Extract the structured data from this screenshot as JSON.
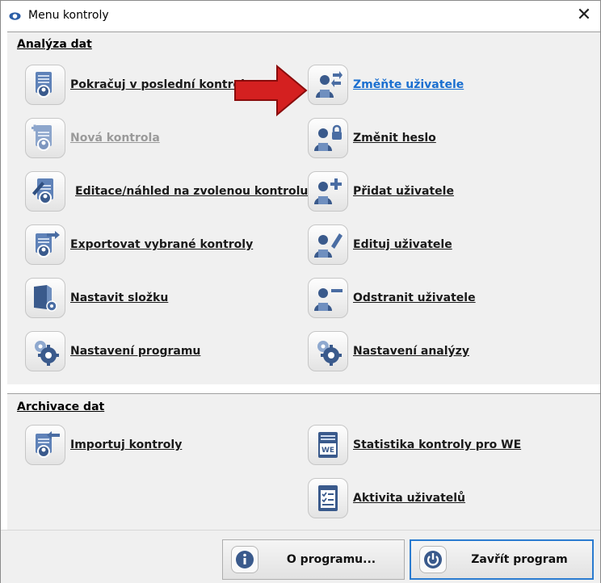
{
  "window": {
    "title": "Menu kontroly",
    "close_glyph": "✕"
  },
  "sections": {
    "analyza": {
      "title": "Analýza dat",
      "left": [
        {
          "label": "Pokračuj v poslední kontrole",
          "icon": "continue-document-icon",
          "state": "normal"
        },
        {
          "label": "Nová kontrola",
          "icon": "new-document-icon",
          "state": "disabled"
        },
        {
          "label": "Editace/náhled na zvolenou kontrolu",
          "icon": "edit-document-icon",
          "state": "normal"
        },
        {
          "label": "Exportovat vybrané kontroly",
          "icon": "export-document-icon",
          "state": "normal"
        },
        {
          "label": "Nastavit složku",
          "icon": "folder-settings-icon",
          "state": "normal"
        },
        {
          "label": "Nastavení programu",
          "icon": "gears-icon",
          "state": "normal"
        }
      ],
      "right": [
        {
          "label": "Změňte uživatele",
          "icon": "switch-user-icon",
          "state": "hover"
        },
        {
          "label": "Změnit heslo",
          "icon": "user-lock-icon",
          "state": "normal"
        },
        {
          "label": "Přidat uživatele",
          "icon": "user-add-icon",
          "state": "normal"
        },
        {
          "label": "Edituj uživatele",
          "icon": "user-edit-icon",
          "state": "normal"
        },
        {
          "label": "Odstranit uživatele",
          "icon": "user-remove-icon",
          "state": "normal"
        },
        {
          "label": "Nastavení analýzy",
          "icon": "gears-icon",
          "state": "normal"
        }
      ]
    },
    "archivace": {
      "title": "Archivace dat",
      "left": [
        {
          "label": "Importuj kontroly",
          "icon": "import-document-icon",
          "state": "normal"
        }
      ],
      "right": [
        {
          "label": "Statistika kontroly pro WE",
          "icon": "statistics-we-icon",
          "state": "normal",
          "badge": "WE"
        },
        {
          "label": "Aktivita uživatelů",
          "icon": "user-activity-icon",
          "state": "normal"
        }
      ]
    }
  },
  "bottom": {
    "about_label": "O programu...",
    "close_label": "Zavřít program"
  },
  "colors": {
    "accent": "#2a7bd0",
    "icon_dark": "#3a5a8c",
    "icon_light": "#6f8fbf",
    "arrow_red": "#d42020"
  }
}
